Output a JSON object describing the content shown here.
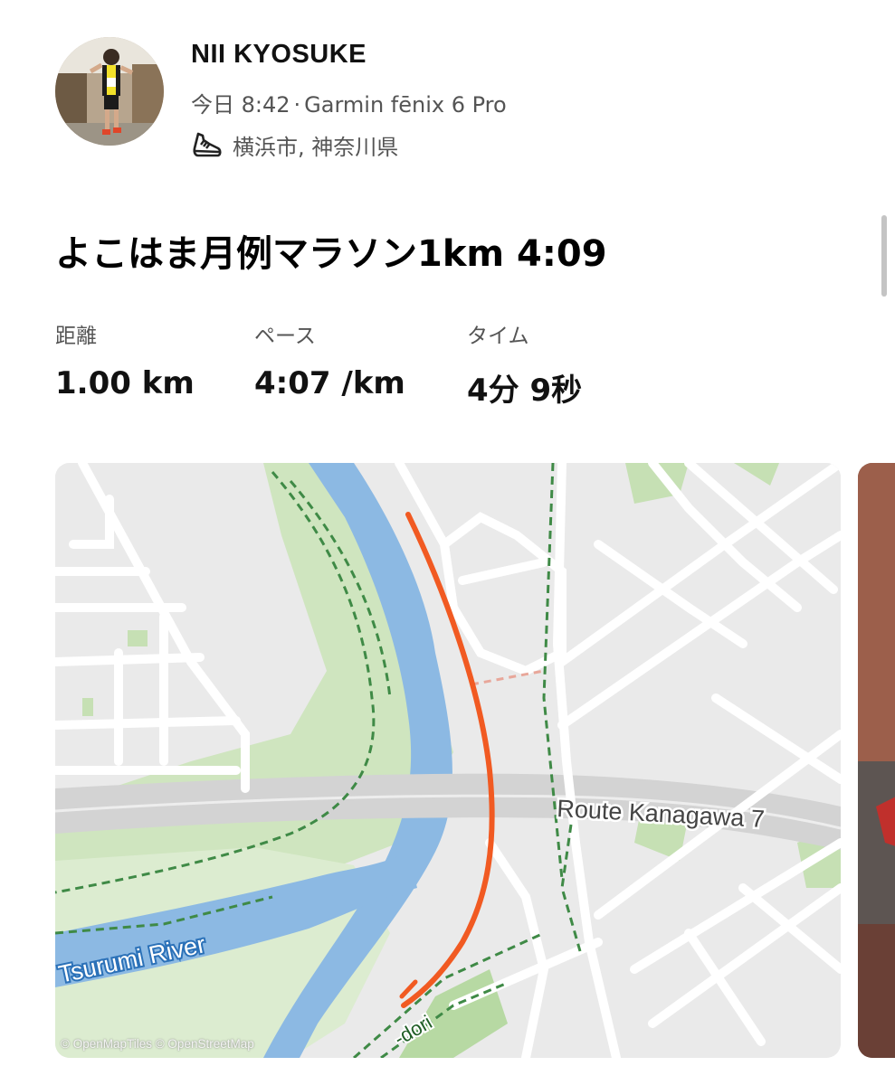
{
  "athlete": {
    "name": "NII KYOSUKE",
    "time": "今日 8:42",
    "separator": "·",
    "device": "Garmin fēnix 6 Pro",
    "activity_icon": "running-shoe-icon",
    "location": "横浜市, 神奈川県"
  },
  "activity": {
    "title": "よこはま月例マラソン1km 4:09"
  },
  "stats": {
    "distance_label": "距離",
    "distance_value": "1.00 km",
    "pace_label": "ペース",
    "pace_value": "4:07 /km",
    "time_label": "タイム",
    "time_value": "4分 9秒"
  },
  "map": {
    "road_label": "Route Kanagawa 7",
    "river_label": "Tsurumi River",
    "street_label": "-dori",
    "attribution": "© OpenMapTiles © OpenStreetMap",
    "colors": {
      "route": "#f15a22",
      "river": "#8cb9e3",
      "park": "#cfe5bf",
      "path": "#3f8a46",
      "background": "#eaeaea"
    }
  }
}
